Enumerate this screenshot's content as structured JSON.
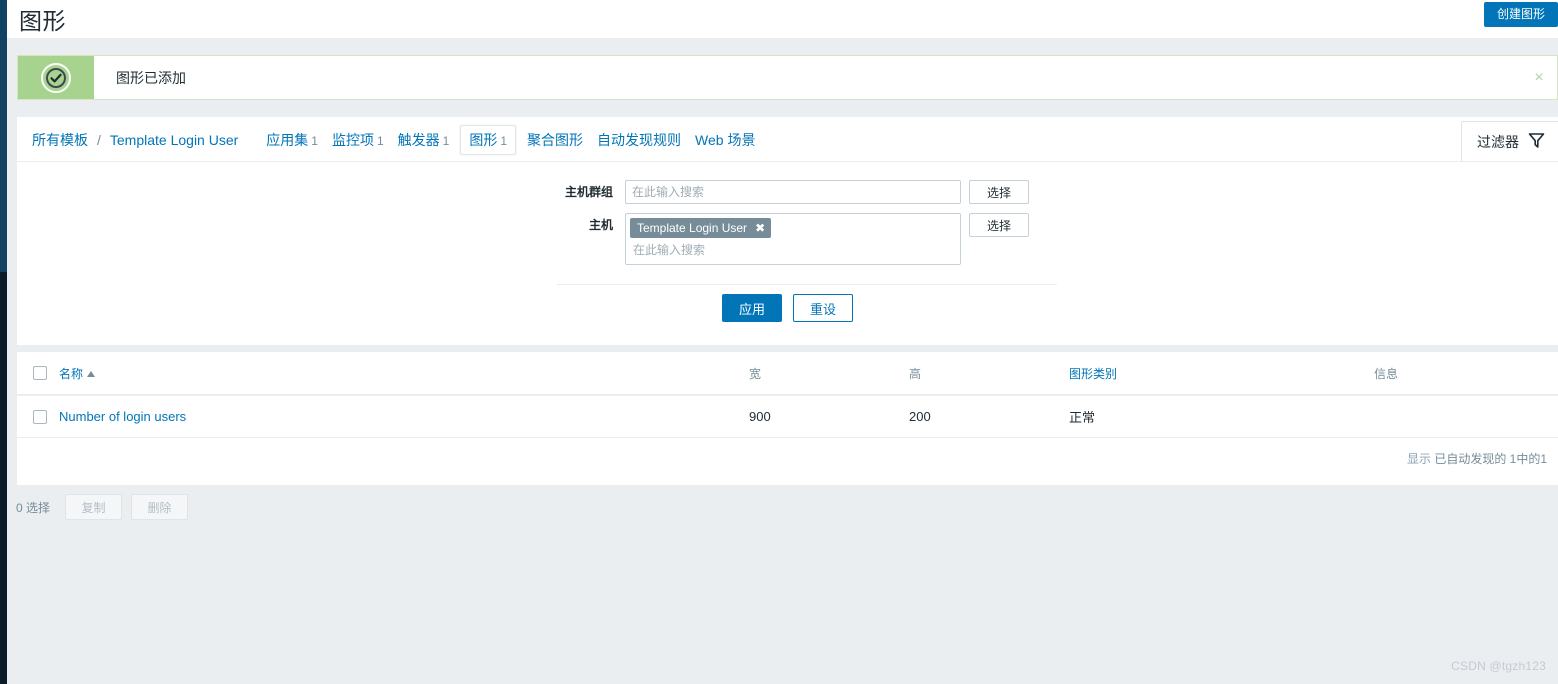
{
  "header": {
    "title": "图形",
    "create_button": "创建图形"
  },
  "message": {
    "text": "图形已添加",
    "icon": "check-circle-icon",
    "close_label": "×",
    "accent_color": "#a7d38e"
  },
  "breadcrumb": {
    "all_templates": "所有模板",
    "separator": "/",
    "template_name": "Template Login User",
    "tabs": [
      {
        "label": "应用集",
        "count": "1",
        "active": false
      },
      {
        "label": "监控项",
        "count": "1",
        "active": false
      },
      {
        "label": "触发器",
        "count": "1",
        "active": false
      },
      {
        "label": "图形",
        "count": "1",
        "active": true
      },
      {
        "label": "聚合图形",
        "count": "",
        "active": false
      },
      {
        "label": "自动发现规则",
        "count": "",
        "active": false
      },
      {
        "label": "Web 场景",
        "count": "",
        "active": false
      }
    ],
    "filter_tab": {
      "label": "过滤器",
      "icon": "filter-funnel-icon"
    }
  },
  "filter": {
    "host_group": {
      "label": "主机群组",
      "placeholder": "在此输入搜索",
      "value": "",
      "select_button": "选择"
    },
    "host": {
      "label": "主机",
      "placeholder": "在此输入搜索",
      "chips": [
        {
          "label": "Template Login User",
          "remove": "✖"
        }
      ],
      "select_button": "选择"
    },
    "apply_button": "应用",
    "reset_button": "重设"
  },
  "table": {
    "columns": [
      "",
      "名称",
      "宽",
      "高",
      "图形类别",
      "信息"
    ],
    "sort_column": "名称",
    "sort_direction": "▲",
    "rows": [
      {
        "name": "Number of login users",
        "width": "900",
        "height": "200",
        "graph_type": "正常",
        "info": ""
      }
    ],
    "footer_prefix": "显示",
    "footer_text": "已自动发现的 1中的1"
  },
  "action_bar": {
    "selected_count": "0 选择",
    "copy_button": "复制",
    "delete_button": "删除"
  },
  "watermark": "CSDN @tgzh123",
  "colors": {
    "accent_blue": "#0275b8",
    "success_green": "#a7d38e",
    "page_bg": "#eaeef1",
    "sidebar_dark": "#0f4263",
    "muted_text": "#768d99"
  }
}
